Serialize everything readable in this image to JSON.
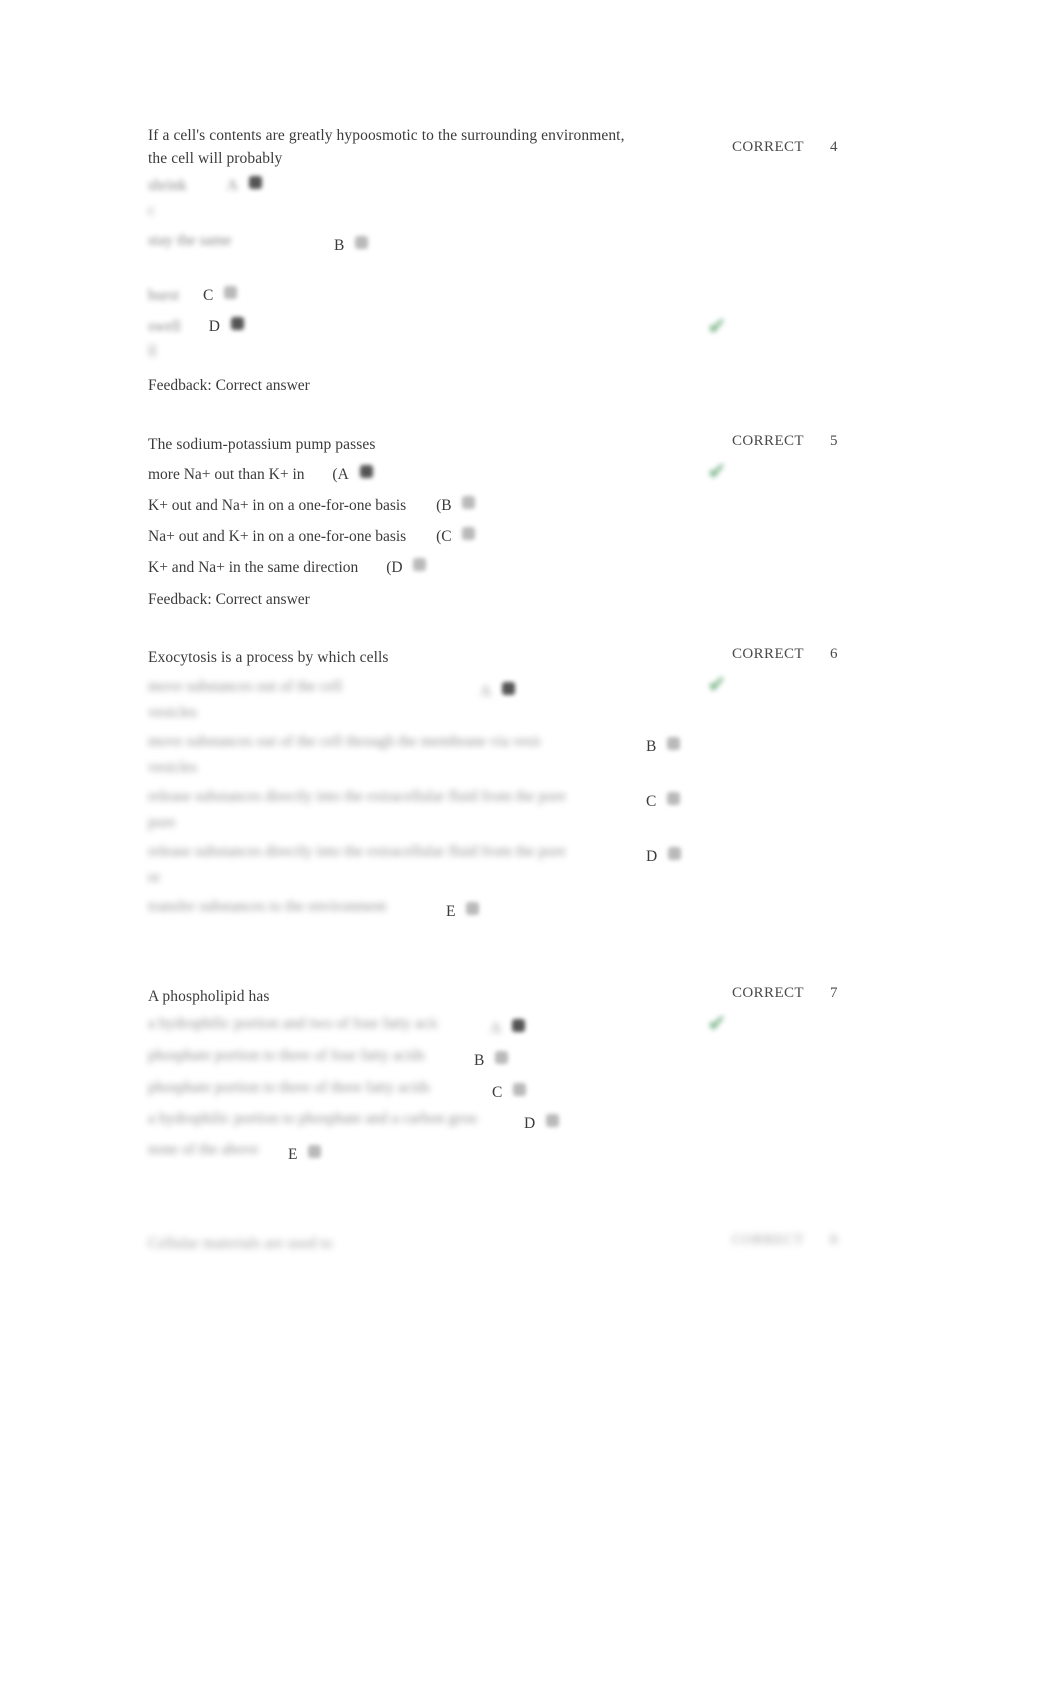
{
  "document": {
    "kind": "quiz-review",
    "status_label": "CORRECT",
    "feedback_text": "Feedback: Correct answer",
    "check_glyph": "✔",
    "accent_green": "#4f9c63",
    "text_color": "#3b3b3b"
  },
  "questions": [
    {
      "number": "4",
      "status": "CORRECT",
      "prompt_line1": "If a cell's contents are greatly hypoosmotic to the surrounding environment,",
      "prompt_line2": "the cell will probably",
      "options": [
        {
          "letter": "A",
          "text": "shrink",
          "legible": false,
          "selected": false
        },
        {
          "letter": "B",
          "text": "stay the same",
          "legible": false,
          "selected": false
        },
        {
          "letter": "C",
          "text": "burst",
          "legible": false,
          "selected": false
        },
        {
          "letter": "D",
          "text": "swell",
          "legible": false,
          "selected": true
        }
      ],
      "feedback": "Feedback: Correct answer",
      "has_check": true
    },
    {
      "number": "5",
      "status": "CORRECT",
      "prompt_line1": "The sodium-potassium pump passes",
      "prompt_line2": "",
      "options": [
        {
          "letter": "A",
          "text": "more Na+ out than K+ in",
          "legible": true,
          "selected": true
        },
        {
          "letter": "B",
          "text": "K+ out and Na+ in on a one-for-one basis",
          "legible": true,
          "selected": false
        },
        {
          "letter": "C",
          "text": "Na+ out and K+ in on a one-for-one basis",
          "legible": true,
          "selected": false
        },
        {
          "letter": "D",
          "text": "K+ and Na+ in the same direction",
          "legible": true,
          "selected": false
        }
      ],
      "feedback": "Feedback: Correct answer",
      "has_check": true
    },
    {
      "number": "6",
      "status": "CORRECT",
      "prompt_line1": "Exocytosis is a process by which cells",
      "prompt_line2": "",
      "options": [
        {
          "letter": "A",
          "text": "move substances out of the cell",
          "legible": false,
          "selected": true
        },
        {
          "letter": "B",
          "text": "move substances out of the cell through the membrane via vesicles",
          "legible": false,
          "selected": false
        },
        {
          "letter": "C",
          "text": "release substances directly into the extracellular fluid from the pore",
          "legible": false,
          "selected": false
        },
        {
          "letter": "D",
          "text": "release substances directly into the extracellular fluid from the pore",
          "legible": false,
          "selected": false
        },
        {
          "letter": "E",
          "text": "transfer substances to the environment",
          "legible": false,
          "selected": false
        }
      ],
      "feedback": "",
      "has_check": true
    },
    {
      "number": "7",
      "status": "CORRECT",
      "prompt_line1": "A phospholipid has",
      "prompt_line2": "",
      "options": [
        {
          "letter": "A",
          "text": "a hydrophilic portion and two of four fatty acid",
          "legible": false,
          "selected": true
        },
        {
          "letter": "B",
          "text": "phosphate portion to three of four fatty acids",
          "legible": false,
          "selected": false
        },
        {
          "letter": "C",
          "text": "phosphate portion to three of three fatty acids",
          "legible": false,
          "selected": false
        },
        {
          "letter": "D",
          "text": "a hydrophilic portion to phosphate and a carbon group",
          "legible": false,
          "selected": false
        },
        {
          "letter": "E",
          "text": "none of the above",
          "legible": false,
          "selected": false
        }
      ],
      "feedback": "",
      "has_check": false
    },
    {
      "number": "8",
      "status": "CORRECT",
      "prompt_line1": "Cellular materials are used to",
      "prompt_line2": "",
      "options": [],
      "feedback": "",
      "has_check": false
    }
  ]
}
